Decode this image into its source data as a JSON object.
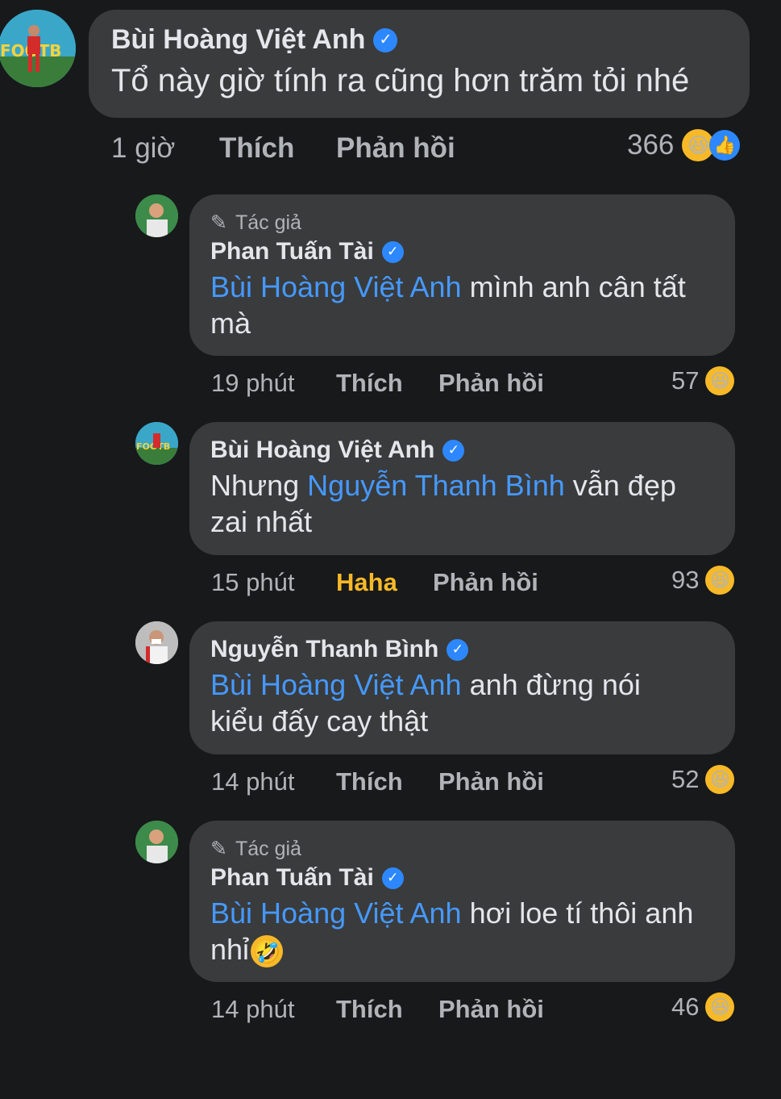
{
  "comments": [
    {
      "name": "Bùi Hoàng Việt Anh",
      "text": "Tổ này giờ tính ra cũng hơn trăm tỏi nhé",
      "time": "1 giờ",
      "like_label": "Thích",
      "reply_label": "Phản hồi",
      "reaction_count": "366",
      "avatar_text": "FOOTB"
    },
    {
      "author_tag": "Tác giả",
      "name": "Phan Tuấn Tài",
      "mention": "Bùi Hoàng Việt Anh",
      "text_line1": " mình anh cân tất",
      "text_line2": "mà",
      "time": "19 phút",
      "like_label": "Thích",
      "reply_label": "Phản hồi",
      "reaction_count": "57"
    },
    {
      "name": "Bùi Hoàng Việt Anh",
      "text_prefix": "Nhưng ",
      "mention": "Nguyễn Thanh Bình",
      "text_suffix": " vẫn đẹp",
      "text_line2": "zai nhất",
      "time": "15 phút",
      "like_label": "Haha",
      "reply_label": "Phản hồi",
      "reaction_count": "93",
      "avatar_text": "FOOTB"
    },
    {
      "name": "Nguyễn Thanh Bình",
      "mention": "Bùi Hoàng Việt Anh",
      "text_line1": " anh đừng nói",
      "text_line2": "kiểu đấy cay thật",
      "time": "14 phút",
      "like_label": "Thích",
      "reply_label": "Phản hồi",
      "reaction_count": "52"
    },
    {
      "author_tag": "Tác giả",
      "name": "Phan Tuấn Tài",
      "mention": "Bùi Hoàng Việt Anh",
      "text_line1": " hơi loe tí thôi anh",
      "text_line2": "nhỉ",
      "time": "14 phút",
      "like_label": "Thích",
      "reply_label": "Phản hồi",
      "reaction_count": "46"
    }
  ],
  "icons": {
    "verified": "verified-badge-icon",
    "pencil": "pencil-icon",
    "haha": "haha-reaction-icon",
    "like": "like-reaction-icon"
  },
  "colors": {
    "background": "#18191a",
    "bubble": "#3a3b3c",
    "mention": "#4599ff",
    "haha": "#f7b928",
    "verified": "#2d88ff"
  }
}
